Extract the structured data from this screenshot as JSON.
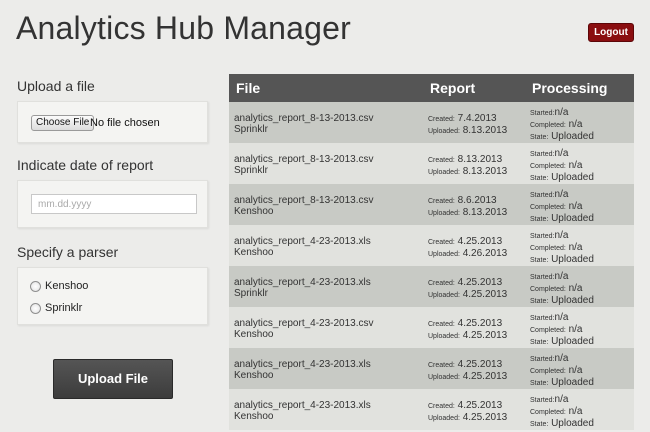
{
  "header": {
    "title": "Analytics Hub Manager",
    "logout_label": "Logout",
    "logout_color": "#8a0e10"
  },
  "upload": {
    "label": "Upload a file",
    "choose_button": "Choose File",
    "no_file_text": "No file chosen"
  },
  "date": {
    "label": "Indicate date of report",
    "placeholder": "mm.dd.yyyy"
  },
  "parser": {
    "label": "Specify a parser",
    "options": [
      "Kenshoo",
      "Sprinklr"
    ]
  },
  "submit": {
    "label": "Upload File"
  },
  "table": {
    "headers": {
      "file": "File",
      "report": "Report",
      "processing": "Processing"
    },
    "labels": {
      "created": "Created:",
      "uploaded": "Uploaded:",
      "started": "Started:",
      "completed": "Completed:",
      "state": "State:"
    },
    "rows": [
      {
        "file": "analytics_report_8-13-2013.csv",
        "parser": "Sprinklr",
        "created": "7.4.2013",
        "uploaded": "8.13.2013",
        "started": "n/a",
        "completed": "n/a",
        "state": "Uploaded"
      },
      {
        "file": "analytics_report_8-13-2013.csv",
        "parser": "Sprinklr",
        "created": "8.13.2013",
        "uploaded": "8.13.2013",
        "started": "n/a",
        "completed": "n/a",
        "state": "Uploaded"
      },
      {
        "file": "analytics_report_8-13-2013.csv",
        "parser": "Kenshoo",
        "created": "8.6.2013",
        "uploaded": "8.13.2013",
        "started": "n/a",
        "completed": "n/a",
        "state": "Uploaded"
      },
      {
        "file": "analytics_report_4-23-2013.xls",
        "parser": "Kenshoo",
        "created": "4.25.2013",
        "uploaded": "4.26.2013",
        "started": "n/a",
        "completed": "n/a",
        "state": "Uploaded"
      },
      {
        "file": "analytics_report_4-23-2013.xls",
        "parser": "Sprinklr",
        "created": "4.25.2013",
        "uploaded": "4.25.2013",
        "started": "n/a",
        "completed": "n/a",
        "state": "Uploaded"
      },
      {
        "file": "analytics_report_4-23-2013.csv",
        "parser": "Kenshoo",
        "created": "4.25.2013",
        "uploaded": "4.25.2013",
        "started": "n/a",
        "completed": "n/a",
        "state": "Uploaded"
      },
      {
        "file": "analytics_report_4-23-2013.xls",
        "parser": "Kenshoo",
        "created": "4.25.2013",
        "uploaded": "4.25.2013",
        "started": "n/a",
        "completed": "n/a",
        "state": "Uploaded"
      },
      {
        "file": "analytics_report_4-23-2013.xls",
        "parser": "Kenshoo",
        "created": "4.25.2013",
        "uploaded": "4.25.2013",
        "started": "n/a",
        "completed": "n/a",
        "state": "Uploaded"
      }
    ]
  }
}
